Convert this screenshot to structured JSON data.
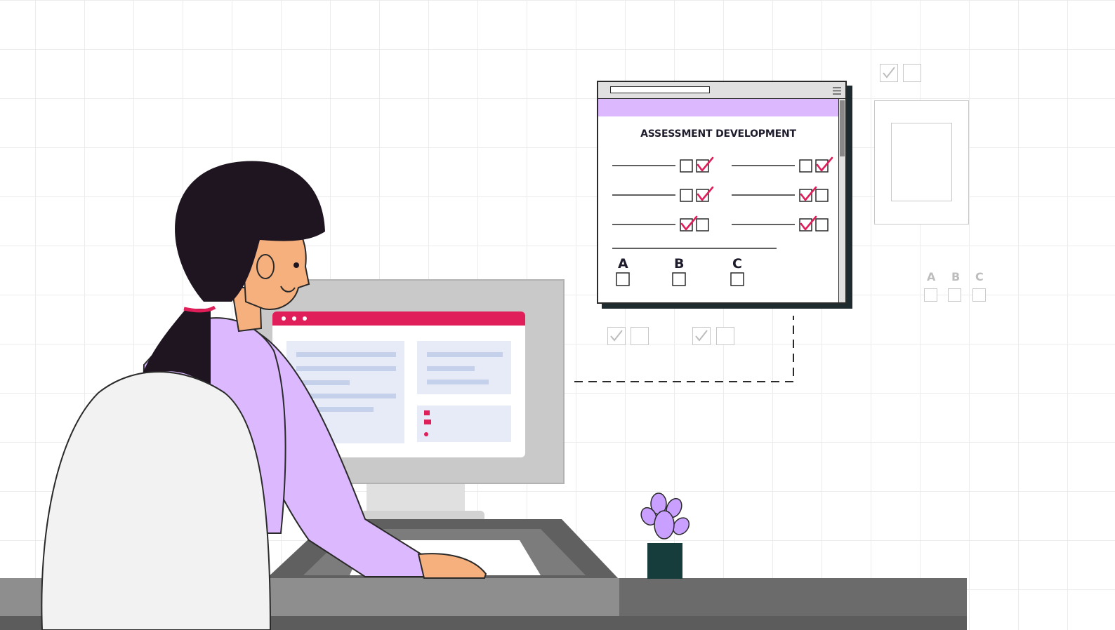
{
  "assessment_window": {
    "title": "ASSESSMENT DEVELOPMENT",
    "choice_labels": [
      "A",
      "B",
      "C"
    ],
    "menu_icon": "hamburger-menu-icon",
    "accent_color": "#dcb8ff",
    "check_color": "#e01e5a"
  },
  "faded_choice_labels": [
    "A",
    "B",
    "C"
  ],
  "monitor": {
    "header_color": "#e01e5a",
    "window_dots": 3
  },
  "colors": {
    "shirt": "#dcb8ff",
    "hair": "#1e1520",
    "skin": "#f6b07d",
    "desk": "#8e8e8e",
    "plant_pot": "#173c3c"
  }
}
